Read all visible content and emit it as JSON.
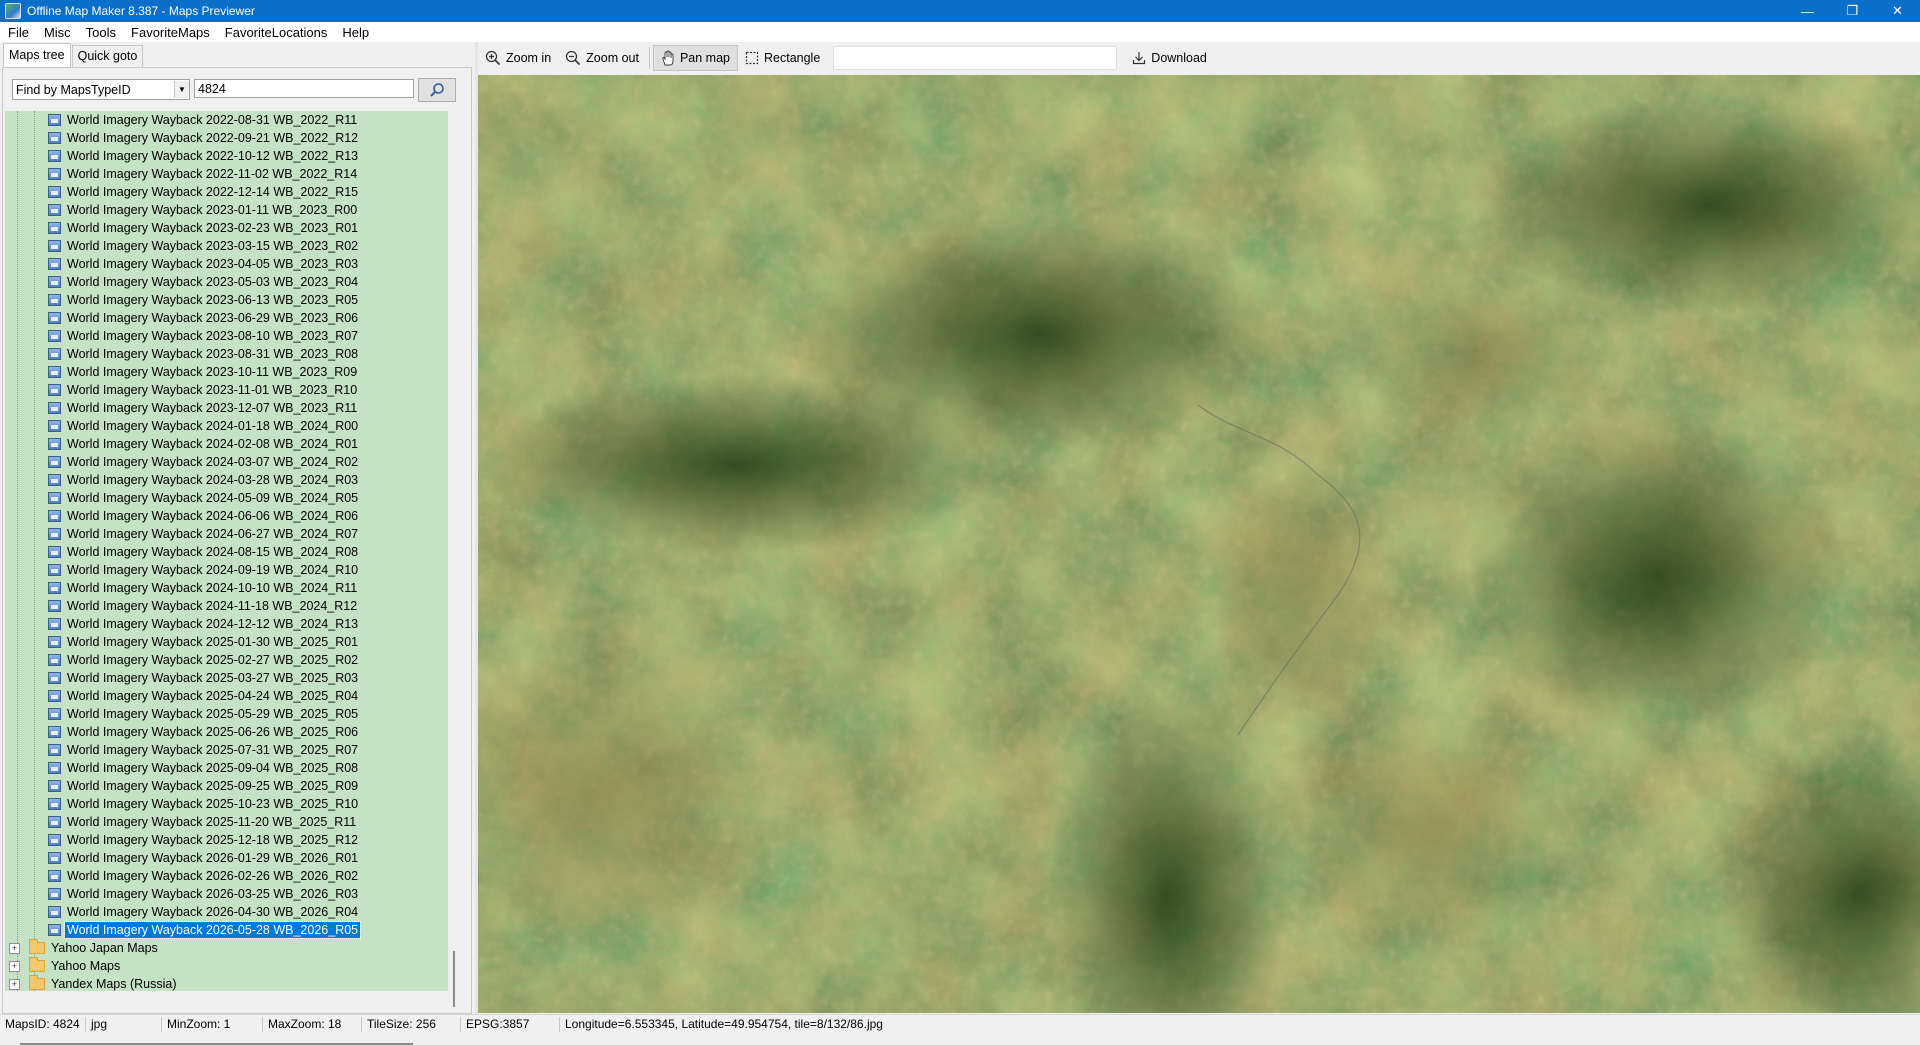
{
  "window": {
    "title": "Offline Map Maker 8.387 - Maps Previewer",
    "controls": [
      "—",
      "❐",
      "✕"
    ]
  },
  "menu": [
    "File",
    "Misc",
    "Tools",
    "FavoriteMaps",
    "FavoriteLocations",
    "Help"
  ],
  "tabs": [
    "Maps tree",
    "Quick goto"
  ],
  "find": {
    "mode": "Find by MapsTypeID",
    "value": "4824"
  },
  "tree": {
    "map_items": [
      "World Imagery Wayback 2022-08-31 WB_2022_R11",
      "World Imagery Wayback 2022-09-21 WB_2022_R12",
      "World Imagery Wayback 2022-10-12 WB_2022_R13",
      "World Imagery Wayback 2022-11-02 WB_2022_R14",
      "World Imagery Wayback 2022-12-14 WB_2022_R15",
      "World Imagery Wayback 2023-01-11 WB_2023_R00",
      "World Imagery Wayback 2023-02-23 WB_2023_R01",
      "World Imagery Wayback 2023-03-15 WB_2023_R02",
      "World Imagery Wayback 2023-04-05 WB_2023_R03",
      "World Imagery Wayback 2023-05-03 WB_2023_R04",
      "World Imagery Wayback 2023-06-13 WB_2023_R05",
      "World Imagery Wayback 2023-06-29 WB_2023_R06",
      "World Imagery Wayback 2023-08-10 WB_2023_R07",
      "World Imagery Wayback 2023-08-31 WB_2023_R08",
      "World Imagery Wayback 2023-10-11 WB_2023_R09",
      "World Imagery Wayback 2023-11-01 WB_2023_R10",
      "World Imagery Wayback 2023-12-07 WB_2023_R11",
      "World Imagery Wayback 2024-01-18 WB_2024_R00",
      "World Imagery Wayback 2024-02-08 WB_2024_R01",
      "World Imagery Wayback 2024-03-07 WB_2024_R02",
      "World Imagery Wayback 2024-03-28 WB_2024_R03",
      "World Imagery Wayback 2024-05-09 WB_2024_R05",
      "World Imagery Wayback 2024-06-06 WB_2024_R06",
      "World Imagery Wayback 2024-06-27 WB_2024_R07",
      "World Imagery Wayback 2024-08-15 WB_2024_R08",
      "World Imagery Wayback 2024-09-19 WB_2024_R10",
      "World Imagery Wayback 2024-10-10 WB_2024_R11",
      "World Imagery Wayback 2024-11-18 WB_2024_R12",
      "World Imagery Wayback 2024-12-12 WB_2024_R13",
      "World Imagery Wayback 2025-01-30 WB_2025_R01",
      "World Imagery Wayback 2025-02-27 WB_2025_R02",
      "World Imagery Wayback 2025-03-27 WB_2025_R03",
      "World Imagery Wayback 2025-04-24 WB_2025_R04",
      "World Imagery Wayback 2025-05-29 WB_2025_R05",
      "World Imagery Wayback 2025-06-26 WB_2025_R06",
      "World Imagery Wayback 2025-07-31 WB_2025_R07",
      "World Imagery Wayback 2025-09-04 WB_2025_R08",
      "World Imagery Wayback 2025-09-25 WB_2025_R09",
      "World Imagery Wayback 2025-10-23 WB_2025_R10",
      "World Imagery Wayback 2025-11-20 WB_2025_R11",
      "World Imagery Wayback 2025-12-18 WB_2025_R12",
      "World Imagery Wayback 2026-01-29 WB_2026_R01",
      "World Imagery Wayback 2026-02-26 WB_2026_R02",
      "World Imagery Wayback 2026-03-25 WB_2026_R03",
      "World Imagery Wayback 2026-04-30 WB_2026_R04",
      "World Imagery Wayback 2026-05-28 WB_2026_R05"
    ],
    "selected_index": 45,
    "folders": [
      "Yahoo Japan Maps",
      "Yahoo Maps",
      "Yandex Maps (Russia)"
    ],
    "expander_symbol": "+"
  },
  "toolbar": {
    "zoom_in": "Zoom in",
    "zoom_out": "Zoom out",
    "pan_map": "Pan map",
    "rectangle": "Rectangle",
    "download": "Download",
    "active_tool": "Pan map"
  },
  "status": {
    "maps_id": "MapsID: 4824",
    "format": "jpg",
    "min_zoom": "MinZoom: 1",
    "max_zoom": "MaxZoom: 18",
    "tile_size": "TileSize: 256",
    "epsg": "EPSG:3857",
    "coords": "Longitude=6.553345, Latitude=49.954754, tile=8/132/86.jpg"
  },
  "colors": {
    "titlebar": "#0a6fc9",
    "tree_background": "#c6e2c4",
    "selection": "#0078d7",
    "map_base": "#4c5d2f"
  }
}
